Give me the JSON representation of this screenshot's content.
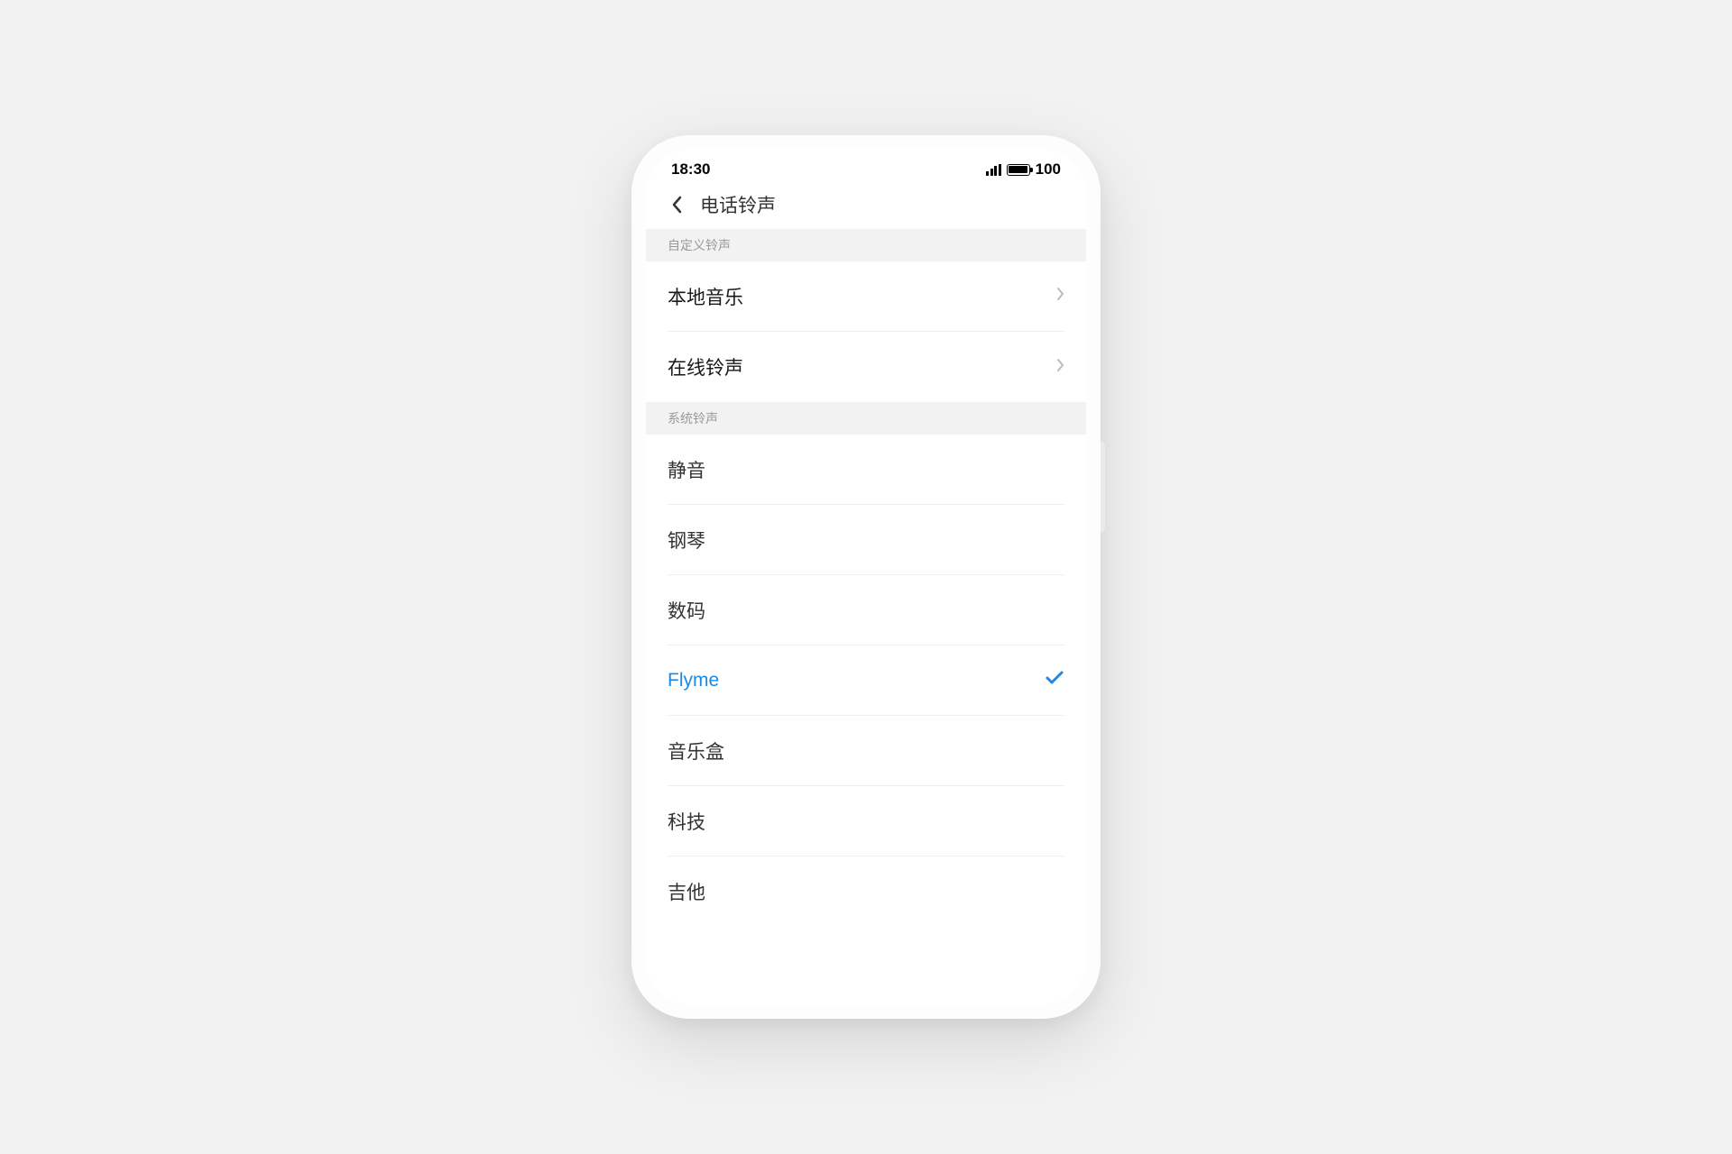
{
  "status_bar": {
    "time": "18:30",
    "battery": "100"
  },
  "header": {
    "title": "电话铃声"
  },
  "sections": {
    "custom": {
      "title": "自定义铃声",
      "items": {
        "local_music": "本地音乐",
        "online_ringtones": "在线铃声"
      }
    },
    "system": {
      "title": "系统铃声",
      "items": {
        "silent": "静音",
        "piano": "钢琴",
        "digital": "数码",
        "flyme": "Flyme",
        "music_box": "音乐盒",
        "tech": "科技",
        "guitar": "吉他"
      },
      "selected": "flyme"
    }
  },
  "colors": {
    "accent": "#1e88e5",
    "section_bg": "#f2f2f2",
    "divider": "#eeeeee",
    "text": "#1a1a1a",
    "muted": "#999999"
  }
}
